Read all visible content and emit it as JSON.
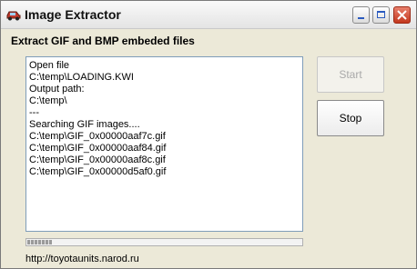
{
  "window": {
    "title": "Image Extractor",
    "buttons": [
      "minimize",
      "maximize",
      "close"
    ]
  },
  "header": {
    "label": "Extract GIF and BMP embeded files"
  },
  "log": {
    "lines": [
      "Open file",
      "C:\\temp\\LOADING.KWI",
      "Output path:",
      "C:\\temp\\",
      "---",
      "Searching GIF images....",
      "C:\\temp\\GIF_0x00000aaf7c.gif",
      "C:\\temp\\GIF_0x00000aaf84.gif",
      "C:\\temp\\GIF_0x00000aaf8c.gif",
      "C:\\temp\\GIF_0x00000d5af0.gif"
    ]
  },
  "actions": {
    "start_label": "Start",
    "start_enabled": false,
    "stop_label": "Stop"
  },
  "progress": {
    "fraction": 0.09
  },
  "footer": {
    "url": "http://toyotaunits.narod.ru"
  },
  "colors": {
    "background": "#ece9d8",
    "border_blue": "#7f9db9",
    "close_red": "#c3371d"
  }
}
